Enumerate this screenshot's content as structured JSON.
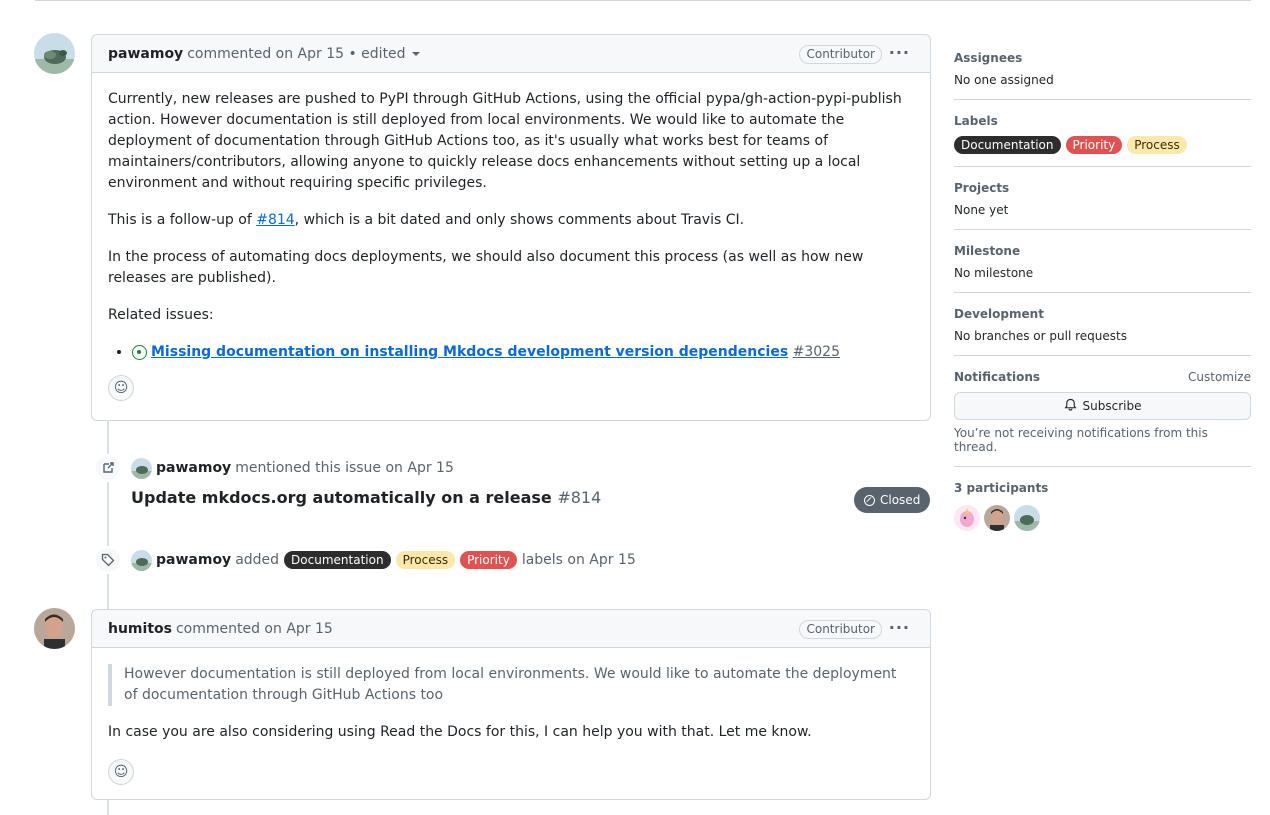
{
  "comment1": {
    "author": "pawamoy",
    "meta": "commented on Apr 15 • edited",
    "role": "Contributor",
    "paragraphs": {
      "p1": "Currently, new releases are pushed to PyPI through GitHub Actions, using the official pypa/gh-action-pypi-publish action. However documentation is still deployed from local environments. We would like to automate the deployment of documentation through GitHub Actions too, as it's usually what works best for teams of maintainers/contributors, allowing anyone to quickly release docs enhancements without setting up a local environment and without requiring specific privileges.",
      "p2_before": "This is a follow-up of ",
      "p2_link": "#814",
      "p2_after": ", which is a bit dated and only shows comments about Travis CI.",
      "p3": "In the process of automating docs deployments, we should also document this process (as well as how new releases are published).",
      "p4": "Related issues:"
    },
    "related_issue": {
      "title": "Missing documentation on installing Mkdocs development version dependencies",
      "number": "#3025"
    }
  },
  "mention_event": {
    "author": "pawamoy",
    "text": "mentioned this issue on Apr 15",
    "ref_title": "Update mkdocs.org automatically on a release",
    "ref_number": "#814",
    "status": "Closed"
  },
  "label_event": {
    "author": "pawamoy",
    "verb": "added",
    "labels": [
      "Documentation",
      "Process",
      "Priority"
    ],
    "suffix": "labels on Apr 15"
  },
  "comment2": {
    "author": "humitos",
    "meta": "commented on Apr 15",
    "role": "Contributor",
    "quote": "However documentation is still deployed from local environments. We would like to automate the deployment of documentation through GitHub Actions too",
    "text": "In case you are also considering using Read the Docs for this, I can help you with that. Let me know."
  },
  "sidebar": {
    "assignees": {
      "title": "Assignees",
      "value": "No one assigned"
    },
    "labels": {
      "title": "Labels",
      "items": [
        "Documentation",
        "Priority",
        "Process"
      ]
    },
    "projects": {
      "title": "Projects",
      "value": "None yet"
    },
    "milestone": {
      "title": "Milestone",
      "value": "No milestone"
    },
    "development": {
      "title": "Development",
      "value": "No branches or pull requests"
    },
    "notifications": {
      "title": "Notifications",
      "customize": "Customize",
      "button": "Subscribe",
      "note": "You’re not receiving notifications from this thread."
    },
    "participants": {
      "title": "3 participants"
    }
  },
  "colors": {
    "documentation": "#2d2d2d",
    "priority": "#e05252",
    "process": "#fde8ac",
    "link": "#0969da",
    "open_issue": "#1a7f37"
  },
  "icons": [
    "kebab-icon",
    "caret-down-icon",
    "smiley-icon",
    "cross-reference-icon",
    "tag-icon",
    "issue-open-icon",
    "issue-closed-icon",
    "bell-icon"
  ]
}
